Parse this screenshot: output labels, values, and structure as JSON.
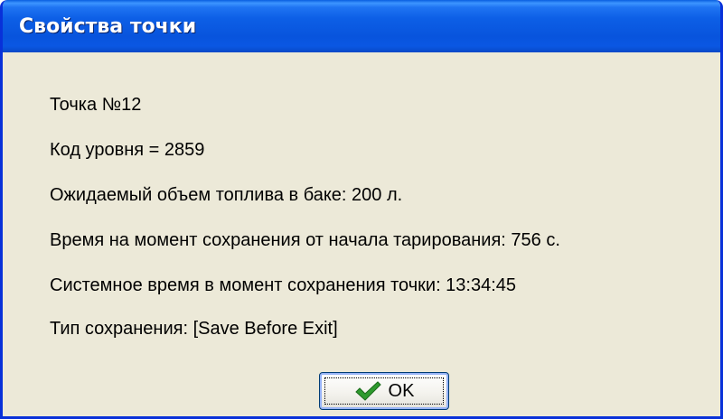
{
  "window": {
    "title": "Свойства точки"
  },
  "properties": {
    "point": "Точка №12",
    "level_code": "Код уровня = 2859",
    "expected_volume": "Ожидаемый объем топлива в баке: 200 л.",
    "elapsed_time": "Время на момент сохранения от начала тарирования: 756 с.",
    "system_time": "Системное время в момент сохранения точки: 13:34:45",
    "save_type": "Тип сохранения: [Save Before Exit]"
  },
  "buttons": {
    "ok_label": "OK",
    "ok_icon": "checkmark-icon"
  },
  "colors": {
    "titlebar": "#0a57e3",
    "dialog_background": "#ece9d8",
    "checkmark": "#2e9a2e"
  }
}
